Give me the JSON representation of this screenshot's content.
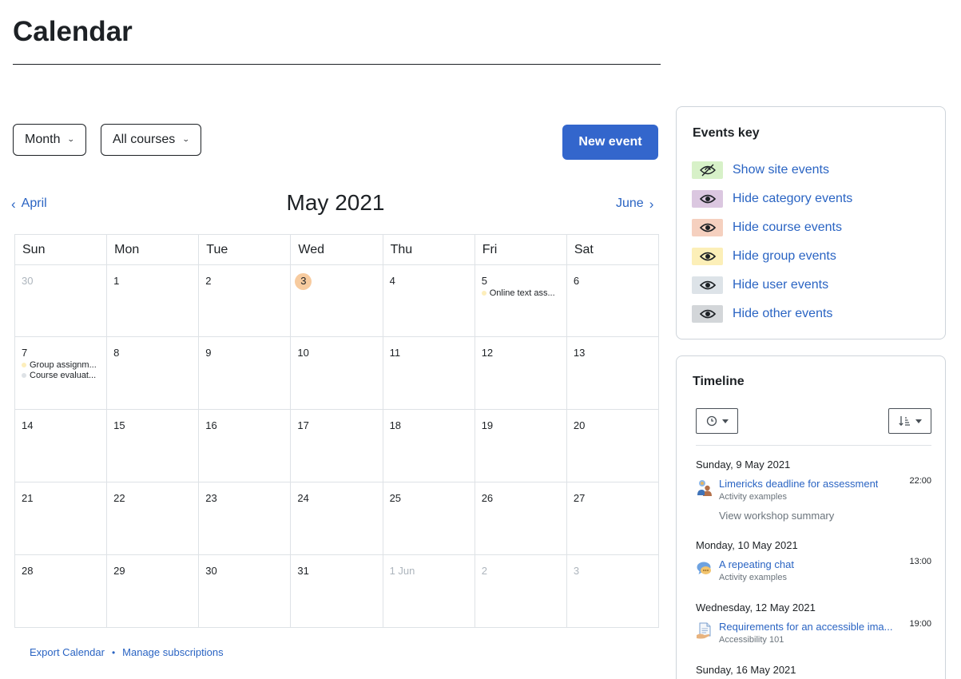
{
  "page": {
    "title": "Calendar"
  },
  "controls": {
    "view_select": "Month",
    "course_select": "All courses",
    "new_event": "New event"
  },
  "calendar": {
    "prev_month": "April",
    "next_month": "June",
    "month_title": "May 2021",
    "weekdays": [
      "Sun",
      "Mon",
      "Tue",
      "Wed",
      "Thu",
      "Fri",
      "Sat"
    ],
    "weeks": [
      [
        {
          "day": "30",
          "muted": true
        },
        {
          "day": "1"
        },
        {
          "day": "2"
        },
        {
          "day": "3",
          "today": true
        },
        {
          "day": "4"
        },
        {
          "day": "5",
          "events": [
            {
              "name": "Online text ass...",
              "color": "#fdeebb"
            }
          ]
        },
        {
          "day": "6"
        }
      ],
      [
        {
          "day": "7",
          "events": [
            {
              "name": "Group assignm...",
              "color": "#fdeebb"
            },
            {
              "name": "Course evaluat...",
              "color": "#dee2e6"
            }
          ]
        },
        {
          "day": "8"
        },
        {
          "day": "9"
        },
        {
          "day": "10"
        },
        {
          "day": "11"
        },
        {
          "day": "12"
        },
        {
          "day": "13"
        }
      ],
      [
        {
          "day": "14"
        },
        {
          "day": "15"
        },
        {
          "day": "16"
        },
        {
          "day": "17"
        },
        {
          "day": "18"
        },
        {
          "day": "19"
        },
        {
          "day": "20"
        }
      ],
      [
        {
          "day": "21"
        },
        {
          "day": "22"
        },
        {
          "day": "23"
        },
        {
          "day": "24"
        },
        {
          "day": "25"
        },
        {
          "day": "26"
        },
        {
          "day": "27"
        }
      ],
      [
        {
          "day": "28"
        },
        {
          "day": "29"
        },
        {
          "day": "30"
        },
        {
          "day": "31"
        },
        {
          "day": "1 Jun",
          "muted": true
        },
        {
          "day": "2",
          "muted": true
        },
        {
          "day": "3",
          "muted": true
        }
      ]
    ],
    "today_color": "#f7cb9f"
  },
  "footer": {
    "export": "Export Calendar",
    "separator": "•",
    "manage": "Manage subscriptions"
  },
  "events_key": {
    "title": "Events key",
    "items": [
      {
        "label": "Show site events",
        "color": "#d7f1c8",
        "icon": "eye-slash-icon"
      },
      {
        "label": "Hide category events",
        "color": "#dbc7e0",
        "icon": "eye-icon"
      },
      {
        "label": "Hide course events",
        "color": "#f5d0bf",
        "icon": "eye-icon"
      },
      {
        "label": "Hide group events",
        "color": "#fcefb8",
        "icon": "eye-icon"
      },
      {
        "label": "Hide user events",
        "color": "#dde3e8",
        "icon": "eye-icon"
      },
      {
        "label": "Hide other events",
        "color": "#d3d6d9",
        "icon": "eye-icon"
      }
    ]
  },
  "timeline": {
    "title": "Timeline",
    "groups": [
      {
        "date": "Sunday, 9 May 2021",
        "items": [
          {
            "name": "Limericks deadline for assessment",
            "course": "Activity examples",
            "time": "22:00",
            "action": "View workshop summary",
            "icon": "workshop-icon"
          }
        ]
      },
      {
        "date": "Monday, 10 May 2021",
        "items": [
          {
            "name": "A repeating chat",
            "course": "Activity examples",
            "time": "13:00",
            "icon": "chat-icon"
          }
        ]
      },
      {
        "date": "Wednesday, 12 May 2021",
        "items": [
          {
            "name": "Requirements for an accessible ima...",
            "course": "Accessibility 101",
            "time": "19:00",
            "icon": "assignment-icon"
          }
        ]
      },
      {
        "date": "Sunday, 16 May 2021",
        "items": []
      }
    ]
  },
  "colors": {
    "link": "#2a64c3",
    "primary_button": "#3366cc"
  }
}
